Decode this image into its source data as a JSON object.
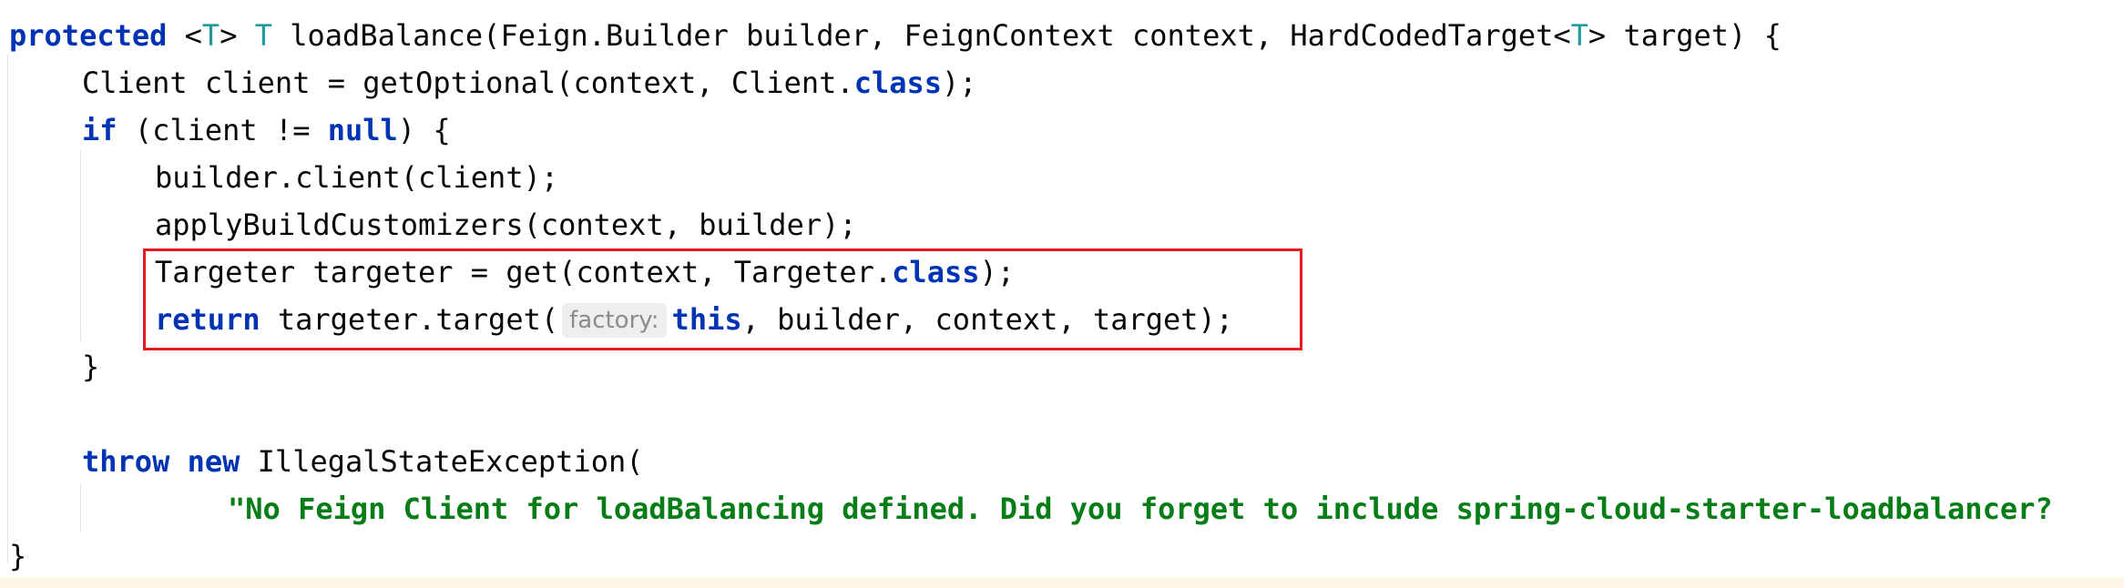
{
  "code": {
    "l1": {
      "kw_protected": "protected",
      "lt1": " <",
      "T1": "T",
      "gt1": "> ",
      "T2": "T",
      "sig1": " loadBalance(Feign.Builder builder, FeignContext context, HardCodedTarget<",
      "T3": "T",
      "sig2": "> target) {"
    },
    "l2": {
      "a": "Client client = getOptional(context, Client.",
      "kw_class": "class",
      "b": ");"
    },
    "l3": {
      "kw_if": "if",
      "a": " (client != ",
      "kw_null": "null",
      "b": ") {"
    },
    "l4": {
      "text": "builder.client(client);"
    },
    "l5": {
      "text": "applyBuildCustomizers(context, builder);"
    },
    "l6": {
      "a": "Targeter targeter = get(context, Targeter.",
      "kw_class": "class",
      "b": ");"
    },
    "l7": {
      "kw_return": "return",
      "a": " targeter.target(",
      "hint": "factory:",
      "kw_this": "this",
      "b": ", builder, context, target);"
    },
    "l8": {
      "text": "}"
    },
    "l10": {
      "kw_throw": "throw",
      "kw_new": "new",
      "a": " IllegalStateException("
    },
    "l11": {
      "str": "\"No Feign Client for loadBalancing defined. Did you forget to include spring-cloud-starter-loadbalancer?"
    },
    "l12": {
      "text": "}"
    }
  },
  "colors": {
    "keyword": "#0033b3",
    "type_param": "#20999d",
    "string": "#067d17",
    "highlight_border": "#e31b23"
  }
}
